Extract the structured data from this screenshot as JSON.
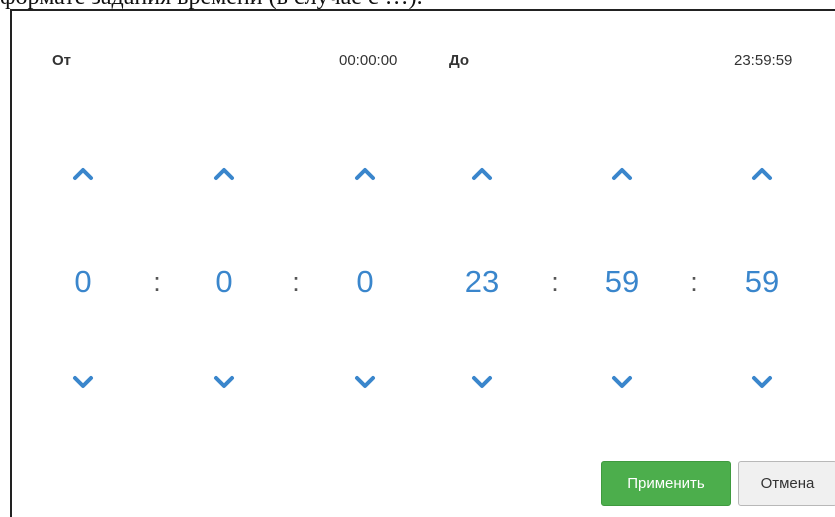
{
  "document": {
    "heading_fragment": "формате задания времени (в случае с …)."
  },
  "picker": {
    "from_label": "От",
    "from_time": "00:00:00",
    "to_label": "До",
    "to_time": "23:59:59",
    "separator": ":",
    "columns": [
      {
        "name": "from-hours",
        "value": "0"
      },
      {
        "name": "from-minutes",
        "value": "0"
      },
      {
        "name": "from-seconds",
        "value": "0"
      },
      {
        "name": "to-hours",
        "value": "23"
      },
      {
        "name": "to-minutes",
        "value": "59"
      },
      {
        "name": "to-seconds",
        "value": "59"
      }
    ],
    "arrow_color": "#3a86cc",
    "up_icon": "chevron-up-icon",
    "down_icon": "chevron-down-icon"
  },
  "buttons": {
    "apply_label": "Применить",
    "cancel_label": "Отмена",
    "apply_color": "#4cae4c"
  }
}
